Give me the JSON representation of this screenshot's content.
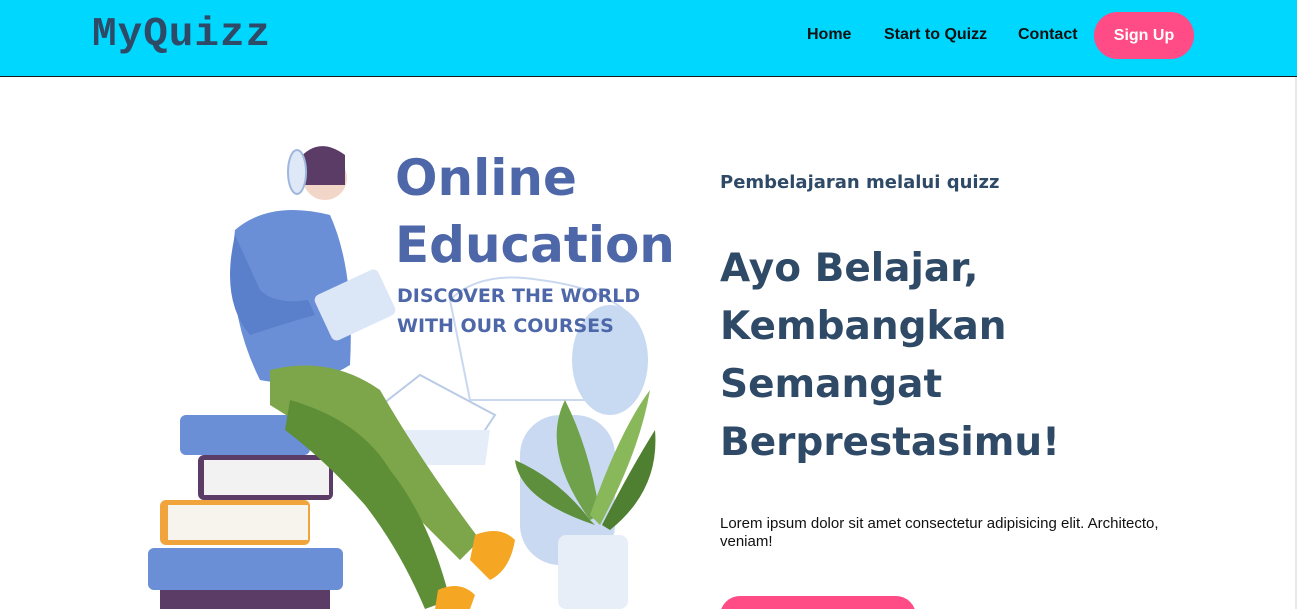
{
  "navbar": {
    "logo": "MyQuizz",
    "links": [
      {
        "label": "Home"
      },
      {
        "label": "Start to Quizz"
      },
      {
        "label": "Contact"
      }
    ],
    "signup_label": "Sign Up",
    "background": "#00d7ff",
    "accent": "#ff4b86"
  },
  "illustration": {
    "heading_line1": "Online",
    "heading_line2": "Education",
    "tagline_line1": "DISCOVER THE WORLD",
    "tagline_line2": "WITH OUR COURSES"
  },
  "hero": {
    "subtitle": "Pembelajaran melalui quizz",
    "title_lines": [
      "Ayo Belajar,",
      "Kembangkan",
      "Semangat",
      "Berprestasimu!"
    ],
    "description": "Lorem ipsum dolor sit amet consectetur adipisicing elit. Architecto, veniam!",
    "text_color": "#2f4a67"
  }
}
